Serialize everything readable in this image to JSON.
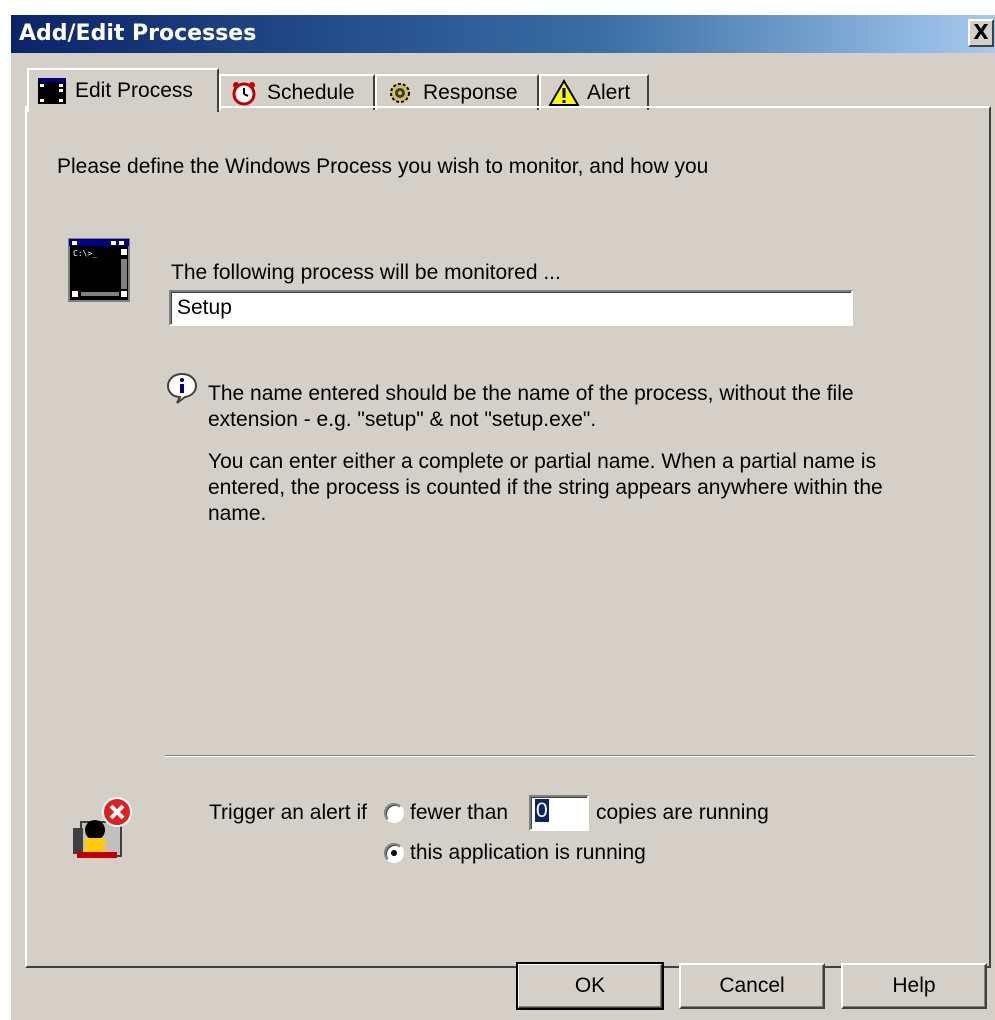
{
  "window": {
    "title": "Add/Edit Processes",
    "close_label": "X"
  },
  "tabs": [
    {
      "label": "Edit Process",
      "icon": "console-icon",
      "active": true
    },
    {
      "label": "Schedule",
      "icon": "alarm-clock-icon",
      "active": false
    },
    {
      "label": "Response",
      "icon": "gears-icon",
      "active": false
    },
    {
      "label": "Alert",
      "icon": "warning-icon",
      "active": false
    }
  ],
  "edit_process": {
    "description": "Please define the Windows Process you wish to monitor, and how you",
    "monitor_label": "The following process will be monitored ...",
    "process_name": "Setup",
    "info_line1": "The name entered should be the name of the process, without the file extension - e.g. \"setup\" & not \"setup.exe\".",
    "info_line2": "You can enter either a complete or partial name. When a partial name is entered, the process is counted if the string appears anywhere within the name.",
    "trigger_label": "Trigger an alert if",
    "option_fewer_label": "fewer than",
    "fewer_count": "0",
    "copies_label": "copies are running",
    "option_running_label": "this application is running",
    "selected_option": "running"
  },
  "buttons": {
    "ok": "OK",
    "cancel": "Cancel",
    "help": "Help"
  },
  "colors": {
    "face": "#d4d0c8",
    "titlebar_start": "#0a246a",
    "titlebar_end": "#a6caf0",
    "selection": "#0a246a"
  }
}
